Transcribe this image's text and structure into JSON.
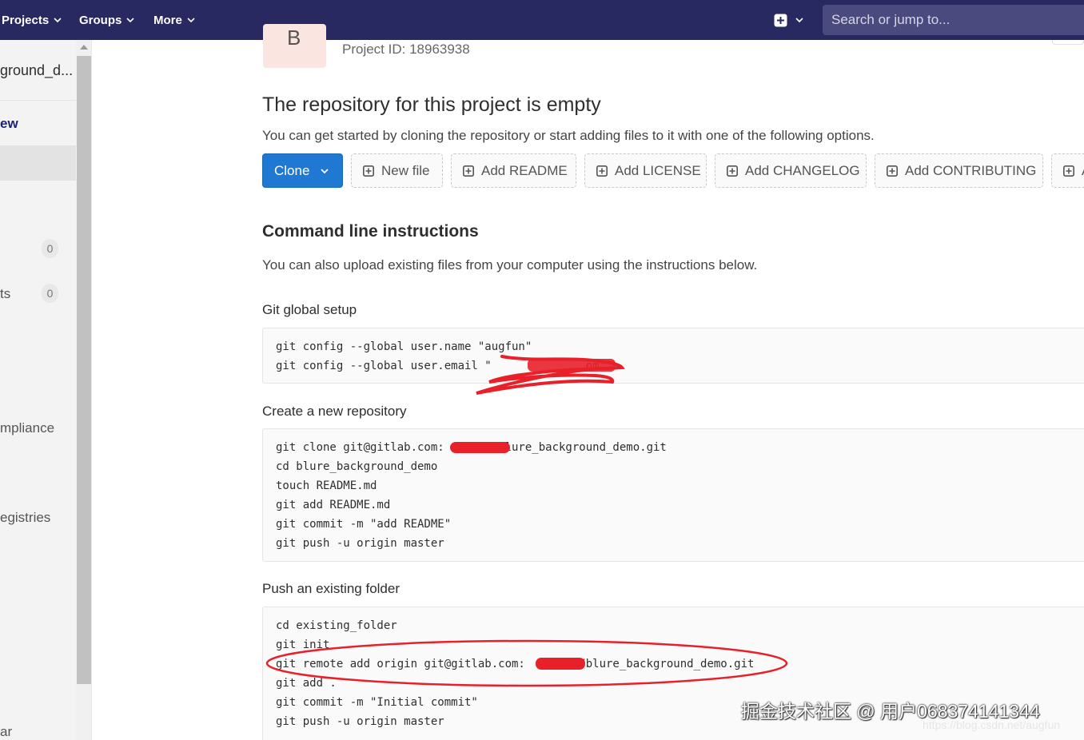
{
  "topnav": {
    "projects": "Projects",
    "groups": "Groups",
    "more": "More",
    "search_placeholder": "Search or jump to..."
  },
  "sidebar": {
    "project_name": "ground_d...",
    "overview": "ew",
    "items": [
      {
        "label": "",
        "badge": "0"
      },
      {
        "label": "ts",
        "badge": "0"
      }
    ],
    "compliance": "mpliance",
    "registries": "egistries",
    "collapse": "ar"
  },
  "project": {
    "avatar_letter": "B",
    "project_id": "Project ID: 18963938"
  },
  "empty": {
    "title": "The repository for this project is empty",
    "subtitle": "You can get started by cloning the repository or start adding files to it with one of the following options."
  },
  "buttons": {
    "clone": "Clone",
    "new_file": "New file",
    "add_readme": "Add README",
    "add_license": "Add LICENSE",
    "add_changelog": "Add CHANGELOG",
    "add_contributing": "Add CONTRIBUTING",
    "add_more": "A"
  },
  "cli": {
    "title": "Command line instructions",
    "subtitle": "You can also upload existing files from your computer using the instructions below.",
    "global_setup_title": "Git global setup",
    "global_setup": [
      "git config --global user.name \"augfun\"",
      "git config --global user.email \"              om\""
    ],
    "new_repo_title": "Create a new repository",
    "new_repo": [
      "git clone git@gitlab.com:       /blure_background_demo.git",
      "cd blure_background_demo",
      "touch README.md",
      "git add README.md",
      "git commit -m \"add README\"",
      "git push -u origin master"
    ],
    "existing_title": "Push an existing folder",
    "existing": [
      "cd existing_folder",
      "git init",
      "git remote add origin git@gitlab.com:       u/blure_background_demo.git",
      "git add .",
      "git commit -m \"Initial commit\"",
      "git push -u origin master"
    ]
  },
  "watermark": {
    "main": "掘金技术社区 @ 用户068374141344",
    "url": "https://blog.csdn.net/augfun"
  },
  "colors": {
    "nav_bg": "#292961",
    "primary": "#1f78d1",
    "annotation_red": "#e8202a"
  }
}
